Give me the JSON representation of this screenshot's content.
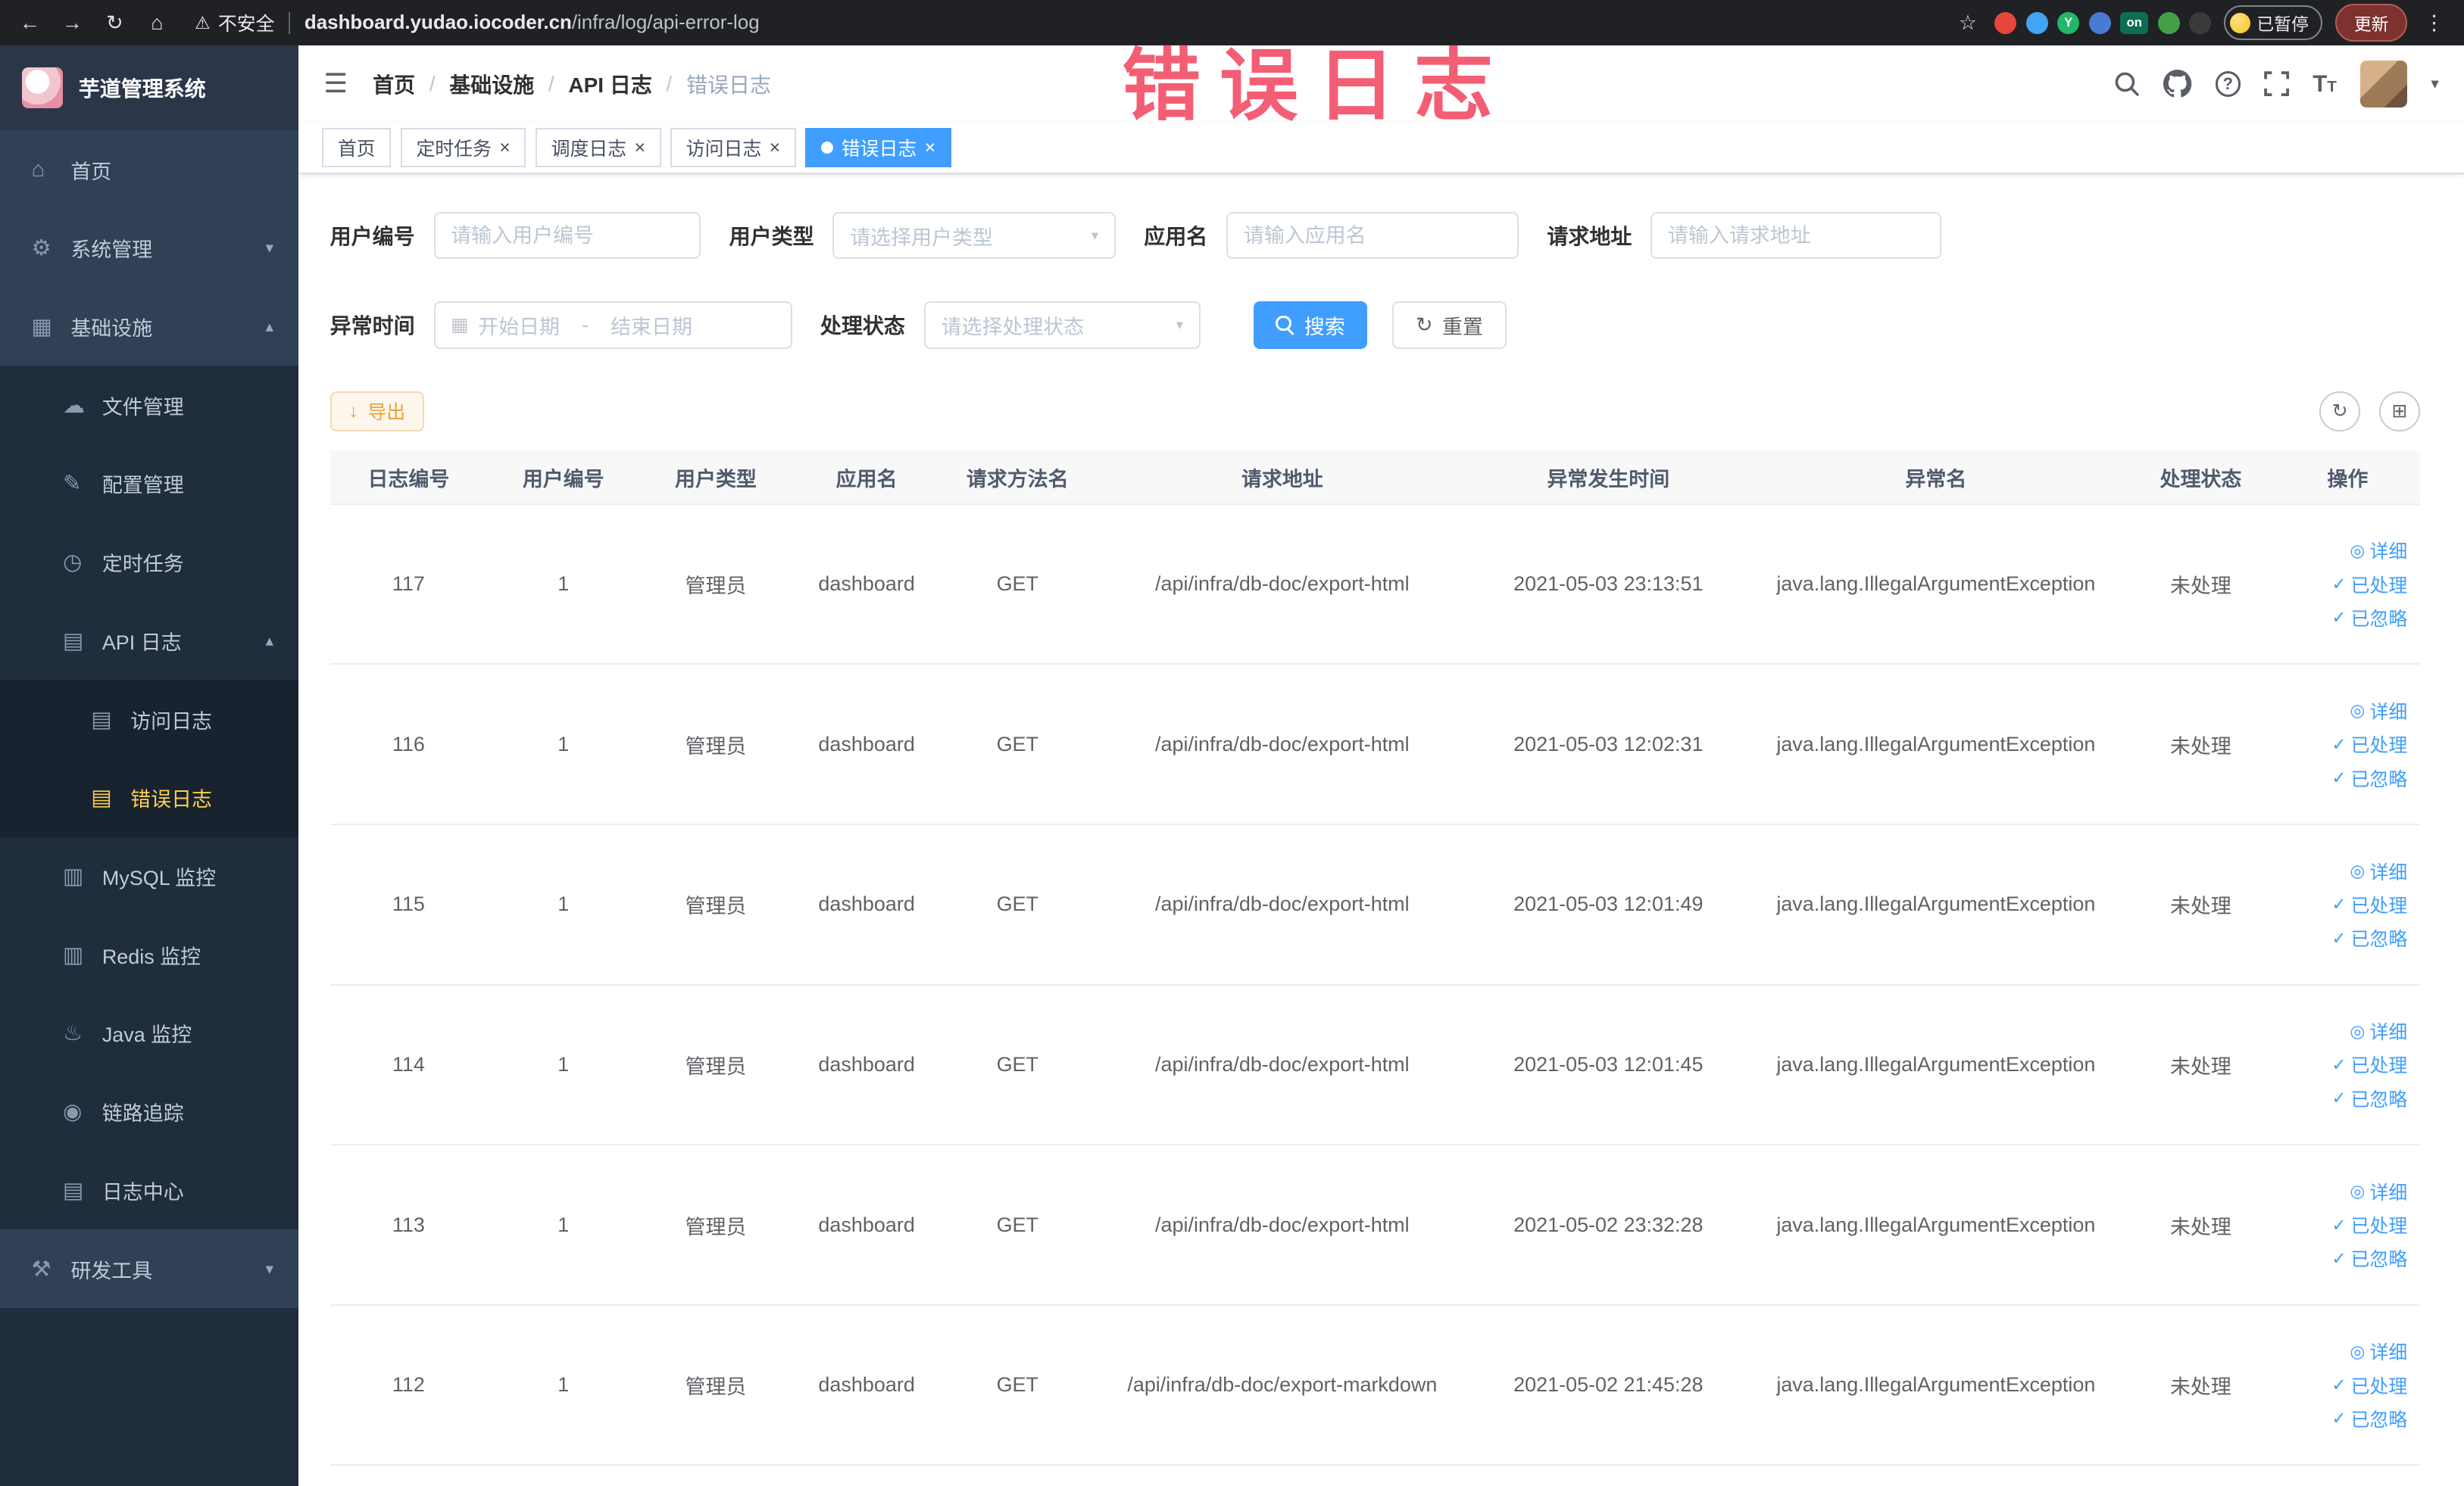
{
  "annotation": {
    "text": "错误日志"
  },
  "browser": {
    "security_label": "不安全",
    "url_domain": "dashboard.yudao.iocoder.cn",
    "url_path": "/infra/log/api-error-log",
    "paused_badge_label": "已暂停",
    "update_button_label": "更新",
    "extensions": [
      {
        "name": "red-circle",
        "color": "#e8453c",
        "letter": ""
      },
      {
        "name": "blue-drop",
        "color": "#41a4f5",
        "letter": ""
      },
      {
        "name": "green-y",
        "color": "#21b868",
        "letter": "Y"
      },
      {
        "name": "blue-grid",
        "color": "#4a7bd4",
        "letter": ""
      },
      {
        "name": "on-badge",
        "color": "#0d6e54",
        "letter": "on"
      },
      {
        "name": "green-leaf",
        "color": "#43a047",
        "letter": ""
      },
      {
        "name": "dark-paw",
        "color": "#3a3a3a",
        "letter": ""
      }
    ]
  },
  "sidebar": {
    "app_title": "芋道管理系统",
    "items": [
      {
        "id": "home",
        "label": "首页",
        "icon": "home",
        "level": 1
      },
      {
        "id": "system-management",
        "label": "系统管理",
        "icon": "gear",
        "level": 1,
        "arrow": "down"
      },
      {
        "id": "infrastructure",
        "label": "基础设施",
        "icon": "monitor",
        "level": 1,
        "arrow": "up"
      },
      {
        "id": "file-management",
        "label": "文件管理",
        "icon": "cloud",
        "level": 2
      },
      {
        "id": "config-management",
        "label": "配置管理",
        "icon": "edit",
        "level": 2
      },
      {
        "id": "scheduled-tasks",
        "label": "定时任务",
        "icon": "clock",
        "level": 2
      },
      {
        "id": "api-log",
        "label": "API 日志",
        "icon": "document",
        "level": 2,
        "arrow": "up"
      },
      {
        "id": "access-log",
        "label": "访问日志",
        "icon": "document",
        "level": 3
      },
      {
        "id": "error-log",
        "label": "错误日志",
        "icon": "document",
        "level": 3,
        "active": true
      },
      {
        "id": "mysql-monitor",
        "label": "MySQL 监控",
        "icon": "database",
        "level": 2
      },
      {
        "id": "redis-monitor",
        "label": "Redis 监控",
        "icon": "database",
        "level": 2
      },
      {
        "id": "java-monitor",
        "label": "Java 监控",
        "icon": "java",
        "level": 2
      },
      {
        "id": "trace",
        "label": "链路追踪",
        "icon": "eye",
        "level": 2
      },
      {
        "id": "log-center",
        "label": "日志中心",
        "icon": "document",
        "level": 2
      },
      {
        "id": "dev-tools",
        "label": "研发工具",
        "icon": "tools",
        "level": 1,
        "arrow": "down"
      }
    ]
  },
  "header": {
    "breadcrumb": [
      "首页",
      "基础设施",
      "API 日志",
      "错误日志"
    ]
  },
  "tabs": [
    {
      "id": "home",
      "label": "首页",
      "closable": false,
      "active": false
    },
    {
      "id": "scheduled-tasks",
      "label": "定时任务",
      "closable": true,
      "active": false
    },
    {
      "id": "schedule-log",
      "label": "调度日志",
      "closable": true,
      "active": false
    },
    {
      "id": "access-log",
      "label": "访问日志",
      "closable": true,
      "active": false
    },
    {
      "id": "error-log",
      "label": "错误日志",
      "closable": true,
      "active": true
    }
  ],
  "filters": {
    "user_id": {
      "label": "用户编号",
      "placeholder": "请输入用户编号"
    },
    "user_type": {
      "label": "用户类型",
      "placeholder": "请选择用户类型"
    },
    "app_name": {
      "label": "应用名",
      "placeholder": "请输入应用名"
    },
    "request_url": {
      "label": "请求地址",
      "placeholder": "请输入请求地址"
    },
    "exception_time": {
      "label": "异常时间",
      "start_placeholder": "开始日期",
      "separator": "-",
      "end_placeholder": "结束日期"
    },
    "process_status": {
      "label": "处理状态",
      "placeholder": "请选择处理状态"
    },
    "search_label": "搜索",
    "reset_label": "重置"
  },
  "toolbar": {
    "export_label": "导出"
  },
  "table": {
    "columns": [
      "日志编号",
      "用户编号",
      "用户类型",
      "应用名",
      "请求方法名",
      "请求地址",
      "异常发生时间",
      "异常名",
      "处理状态",
      "操作"
    ],
    "operations": [
      {
        "id": "detail",
        "label": "详细",
        "icon": "eye-outline"
      },
      {
        "id": "processed",
        "label": "已处理",
        "icon": "check"
      },
      {
        "id": "ignored",
        "label": "已忽略",
        "icon": "check"
      }
    ],
    "rows": [
      {
        "log_id": "117",
        "user_id": "1",
        "user_type": "管理员",
        "app_name": "dashboard",
        "method": "GET",
        "url": "/api/infra/db-doc/export-html",
        "time": "2021-05-03 23:13:51",
        "exception": "java.lang.IllegalArgumentException",
        "status": "未处理"
      },
      {
        "log_id": "116",
        "user_id": "1",
        "user_type": "管理员",
        "app_name": "dashboard",
        "method": "GET",
        "url": "/api/infra/db-doc/export-html",
        "time": "2021-05-03 12:02:31",
        "exception": "java.lang.IllegalArgumentException",
        "status": "未处理"
      },
      {
        "log_id": "115",
        "user_id": "1",
        "user_type": "管理员",
        "app_name": "dashboard",
        "method": "GET",
        "url": "/api/infra/db-doc/export-html",
        "time": "2021-05-03 12:01:49",
        "exception": "java.lang.IllegalArgumentException",
        "status": "未处理"
      },
      {
        "log_id": "114",
        "user_id": "1",
        "user_type": "管理员",
        "app_name": "dashboard",
        "method": "GET",
        "url": "/api/infra/db-doc/export-html",
        "time": "2021-05-03 12:01:45",
        "exception": "java.lang.IllegalArgumentException",
        "status": "未处理"
      },
      {
        "log_id": "113",
        "user_id": "1",
        "user_type": "管理员",
        "app_name": "dashboard",
        "method": "GET",
        "url": "/api/infra/db-doc/export-html",
        "time": "2021-05-02 23:32:28",
        "exception": "java.lang.IllegalArgumentException",
        "status": "未处理"
      },
      {
        "log_id": "112",
        "user_id": "1",
        "user_type": "管理员",
        "app_name": "dashboard",
        "method": "GET",
        "url": "/api/infra/db-doc/export-markdown",
        "time": "2021-05-02 21:45:28",
        "exception": "java.lang.IllegalArgumentException",
        "status": "未处理"
      }
    ]
  },
  "icon_glyphs": {
    "back": "←",
    "forward": "→",
    "reload": "↻",
    "home_nav": "⌂",
    "warning": "⚠",
    "star": "☆",
    "kebab": "⋮",
    "hamburger": "☰",
    "caret": "▾",
    "calendar": "▦",
    "refresh": "↻",
    "grid": "⊞",
    "download": "↓",
    "home": "⌂",
    "gear": "⚙",
    "monitor": "▦",
    "cloud": "☁",
    "edit": "✎",
    "clock": "◷",
    "document": "▤",
    "database": "▥",
    "java": "♨",
    "eye": "◉",
    "tools": "⚒",
    "arrow-up": "▴",
    "arrow-down": "▾",
    "eye-outline": "◎",
    "check": "✓",
    "fontsize": "T"
  },
  "colors": {
    "primary": "#409eff",
    "sidebar_bg": "#304156",
    "sidebar_dark_bg": "#1f2d3d",
    "menu_active_text": "#ffd04b",
    "annotation_red": "#f3516a",
    "export_text": "#e6a23c",
    "export_bg": "#fdf6ec",
    "export_border": "#f5dab1"
  }
}
